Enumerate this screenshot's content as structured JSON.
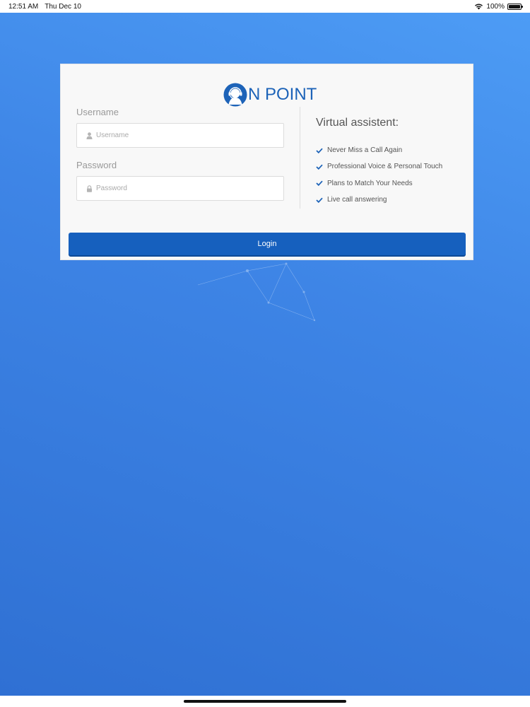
{
  "status_bar": {
    "time": "12:51 AM",
    "date": "Thu Dec 10",
    "battery": "100%",
    "battery_level": 1.0
  },
  "logo": {
    "text": "N POINT",
    "icon": "headset-agent-icon",
    "color": "#1d63b8"
  },
  "form": {
    "username_label": "Username",
    "username_placeholder": "Username",
    "username_value": "",
    "password_label": "Password",
    "password_placeholder": "Password",
    "password_value": "",
    "login_label": "Login"
  },
  "features": {
    "title": "Virtual assistent:",
    "items": [
      "Never Miss a Call Again",
      "Professional Voice & Personal Touch",
      "Plans to Match Your Needs",
      "Live call answering"
    ]
  },
  "colors": {
    "accent": "#1660be",
    "background": "#3e85e6",
    "check": "#1d63b8"
  }
}
